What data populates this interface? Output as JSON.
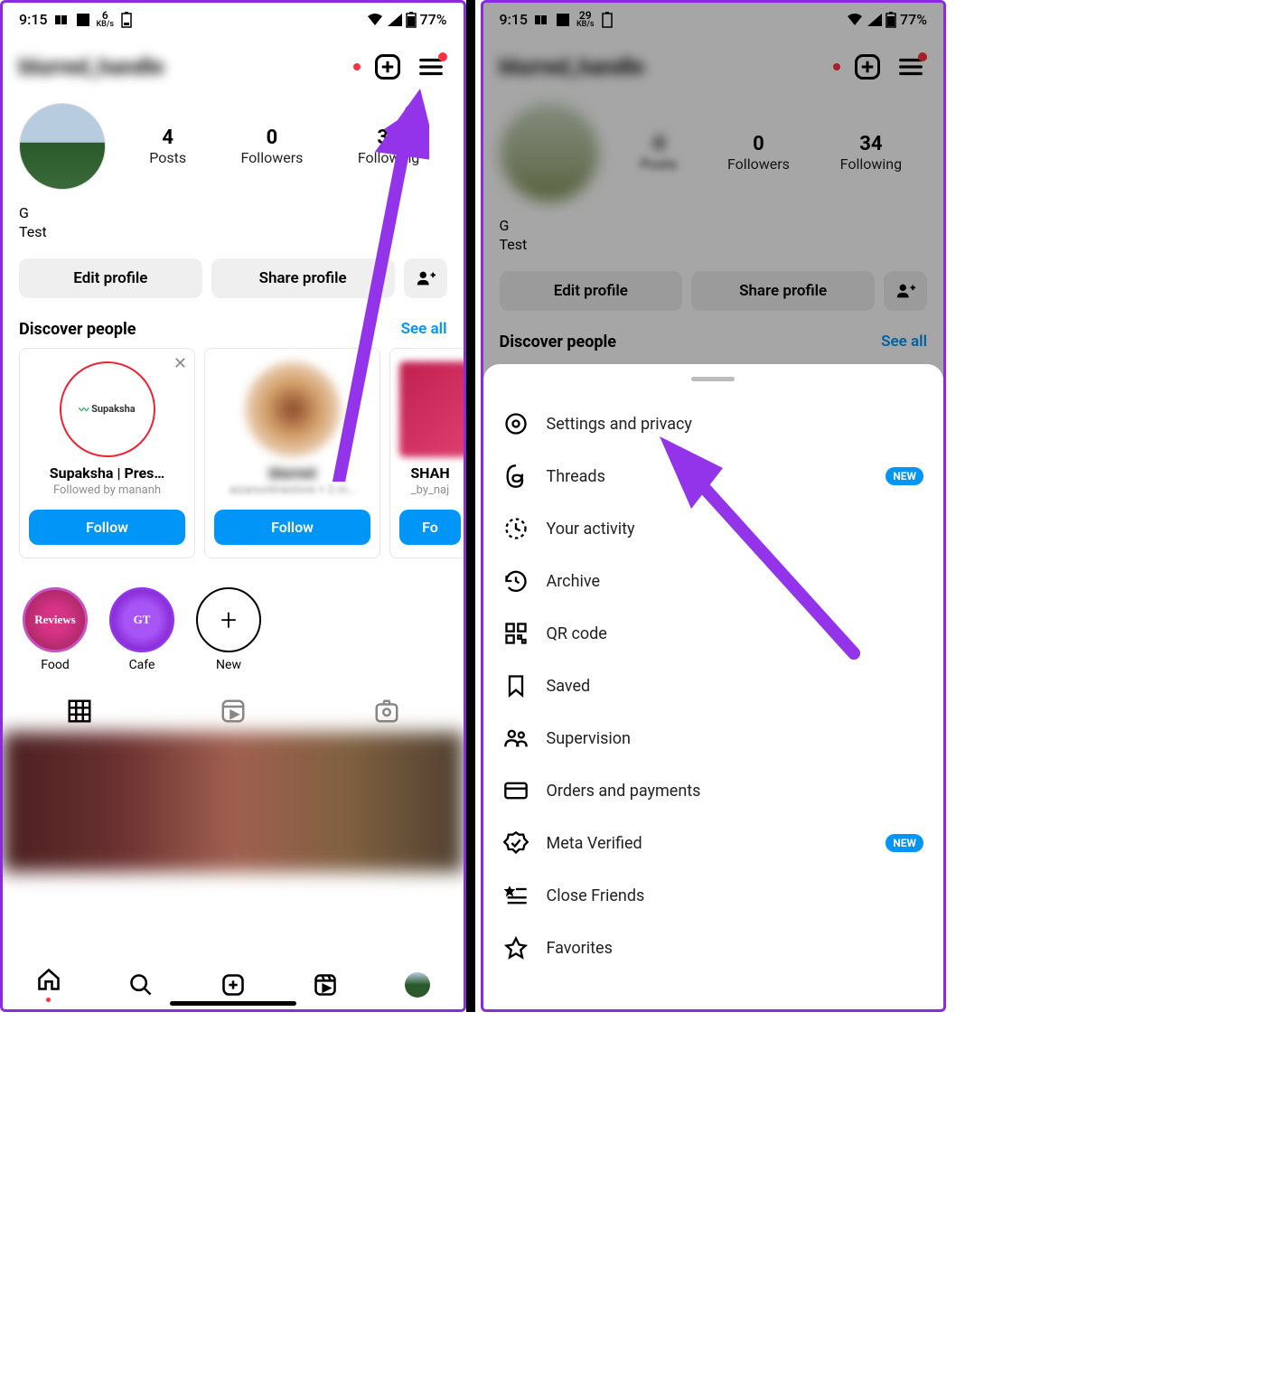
{
  "status": {
    "time": "9:15",
    "kb_left": "6",
    "kb_right": "29",
    "kb_unit": "KB/s",
    "battery": "77%"
  },
  "header": {
    "username_blurred": "blurred_handle",
    "create_icon": "plus-square",
    "menu_icon": "hamburger"
  },
  "stats": {
    "posts_v": "4",
    "posts_l": "Posts",
    "followers_v": "0",
    "followers_l": "Followers",
    "following_v": "34",
    "following_l": "Following"
  },
  "profile": {
    "name": "G",
    "bio": "Test"
  },
  "actions": {
    "edit": "Edit profile",
    "share": "Share profile"
  },
  "discover": {
    "title": "Discover people",
    "see_all": "See all",
    "cards": [
      {
        "avatar_text": "Supaksha",
        "name": "Supaksha | Pres…",
        "sub": "Followed by mananh",
        "follow": "Follow"
      },
      {
        "name_blur": "blurred",
        "sub": "aizanonlinestore + 2 m…",
        "follow": "Follow"
      },
      {
        "name": "SHAH",
        "sub": "_by_naj",
        "follow": "Fo"
      }
    ]
  },
  "highlights": [
    {
      "label": "Food",
      "inner": "Reviews"
    },
    {
      "label": "Cafe",
      "inner": "GT"
    },
    {
      "label": "New",
      "plus": "+"
    }
  ],
  "menu": {
    "items": [
      {
        "icon": "gear-icon",
        "label": "Settings and privacy"
      },
      {
        "icon": "threads-icon",
        "label": "Threads",
        "badge": "NEW"
      },
      {
        "icon": "activity-icon",
        "label": "Your activity"
      },
      {
        "icon": "archive-icon",
        "label": "Archive"
      },
      {
        "icon": "qr-icon",
        "label": "QR code"
      },
      {
        "icon": "bookmark-icon",
        "label": "Saved"
      },
      {
        "icon": "supervision-icon",
        "label": "Supervision"
      },
      {
        "icon": "card-icon",
        "label": "Orders and payments"
      },
      {
        "icon": "verified-icon",
        "label": "Meta Verified",
        "badge": "NEW"
      },
      {
        "icon": "star-list-icon",
        "label": "Close Friends"
      },
      {
        "icon": "star-icon",
        "label": "Favorites"
      }
    ]
  }
}
